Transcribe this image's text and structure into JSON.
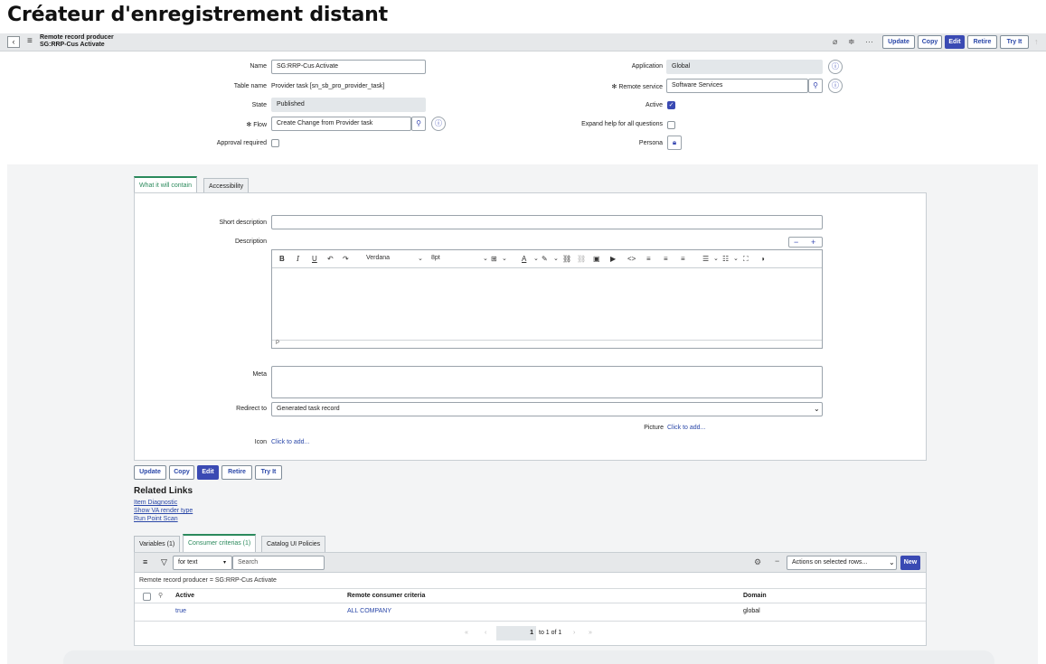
{
  "page_title": "Créateur d'enregistrement distant",
  "header": {
    "record_type": "Remote record producer",
    "record_name": "SG:RRP-Cus Activate",
    "buttons": [
      "Update",
      "Copy",
      "Edit",
      "Retire",
      "Try It"
    ]
  },
  "form": {
    "name_label": "Name",
    "name_value": "SG:RRP-Cus Activate",
    "table_label": "Table name",
    "table_value": "Provider task [sn_sb_pro_provider_task]",
    "state_label": "State",
    "state_value": "Published",
    "flow_label": "Flow",
    "flow_value": "Create Change from Provider task",
    "approval_label": "Approval required",
    "application_label": "Application",
    "application_value": "Global",
    "remote_service_label": "Remote service",
    "remote_service_value": "Software Services",
    "active_label": "Active",
    "expand_label": "Expand help for all questions",
    "persona_label": "Persona",
    "required_mark": "✻"
  },
  "tabs": [
    "What it will contain",
    "Accessibility"
  ],
  "content": {
    "short_desc_label": "Short description",
    "description_label": "Description",
    "font_name": "Verdana",
    "font_size": "8pt",
    "editor_footer": "P",
    "meta_label": "Meta",
    "redirect_label": "Redirect to",
    "redirect_value": "Generated task record",
    "picture_label": "Picture",
    "picture_action": "Click to add...",
    "icon_label": "Icon",
    "icon_action": "Click to add..."
  },
  "bottom_buttons": [
    "Update",
    "Copy",
    "Edit",
    "Retire",
    "Try It"
  ],
  "related": {
    "title": "Related Links",
    "links": [
      "Item Diagnostic",
      "Show VA render type",
      "Run Point Scan"
    ]
  },
  "list_tabs": [
    "Variables (1)",
    "Consumer criterias (1)",
    "Catalog UI Policies"
  ],
  "list": {
    "filter_select": "for text",
    "search_placeholder": "Search",
    "actions_select": "Actions on selected rows...",
    "new_label": "New",
    "breadcrumb": "Remote record producer = SG:RRP-Cus Activate",
    "columns": [
      "Active",
      "Remote consumer criteria",
      "Domain"
    ],
    "rows": [
      [
        "true",
        "ALL COMPANY",
        "global"
      ]
    ],
    "page_current": "1",
    "page_info": "to 1 of 1"
  }
}
